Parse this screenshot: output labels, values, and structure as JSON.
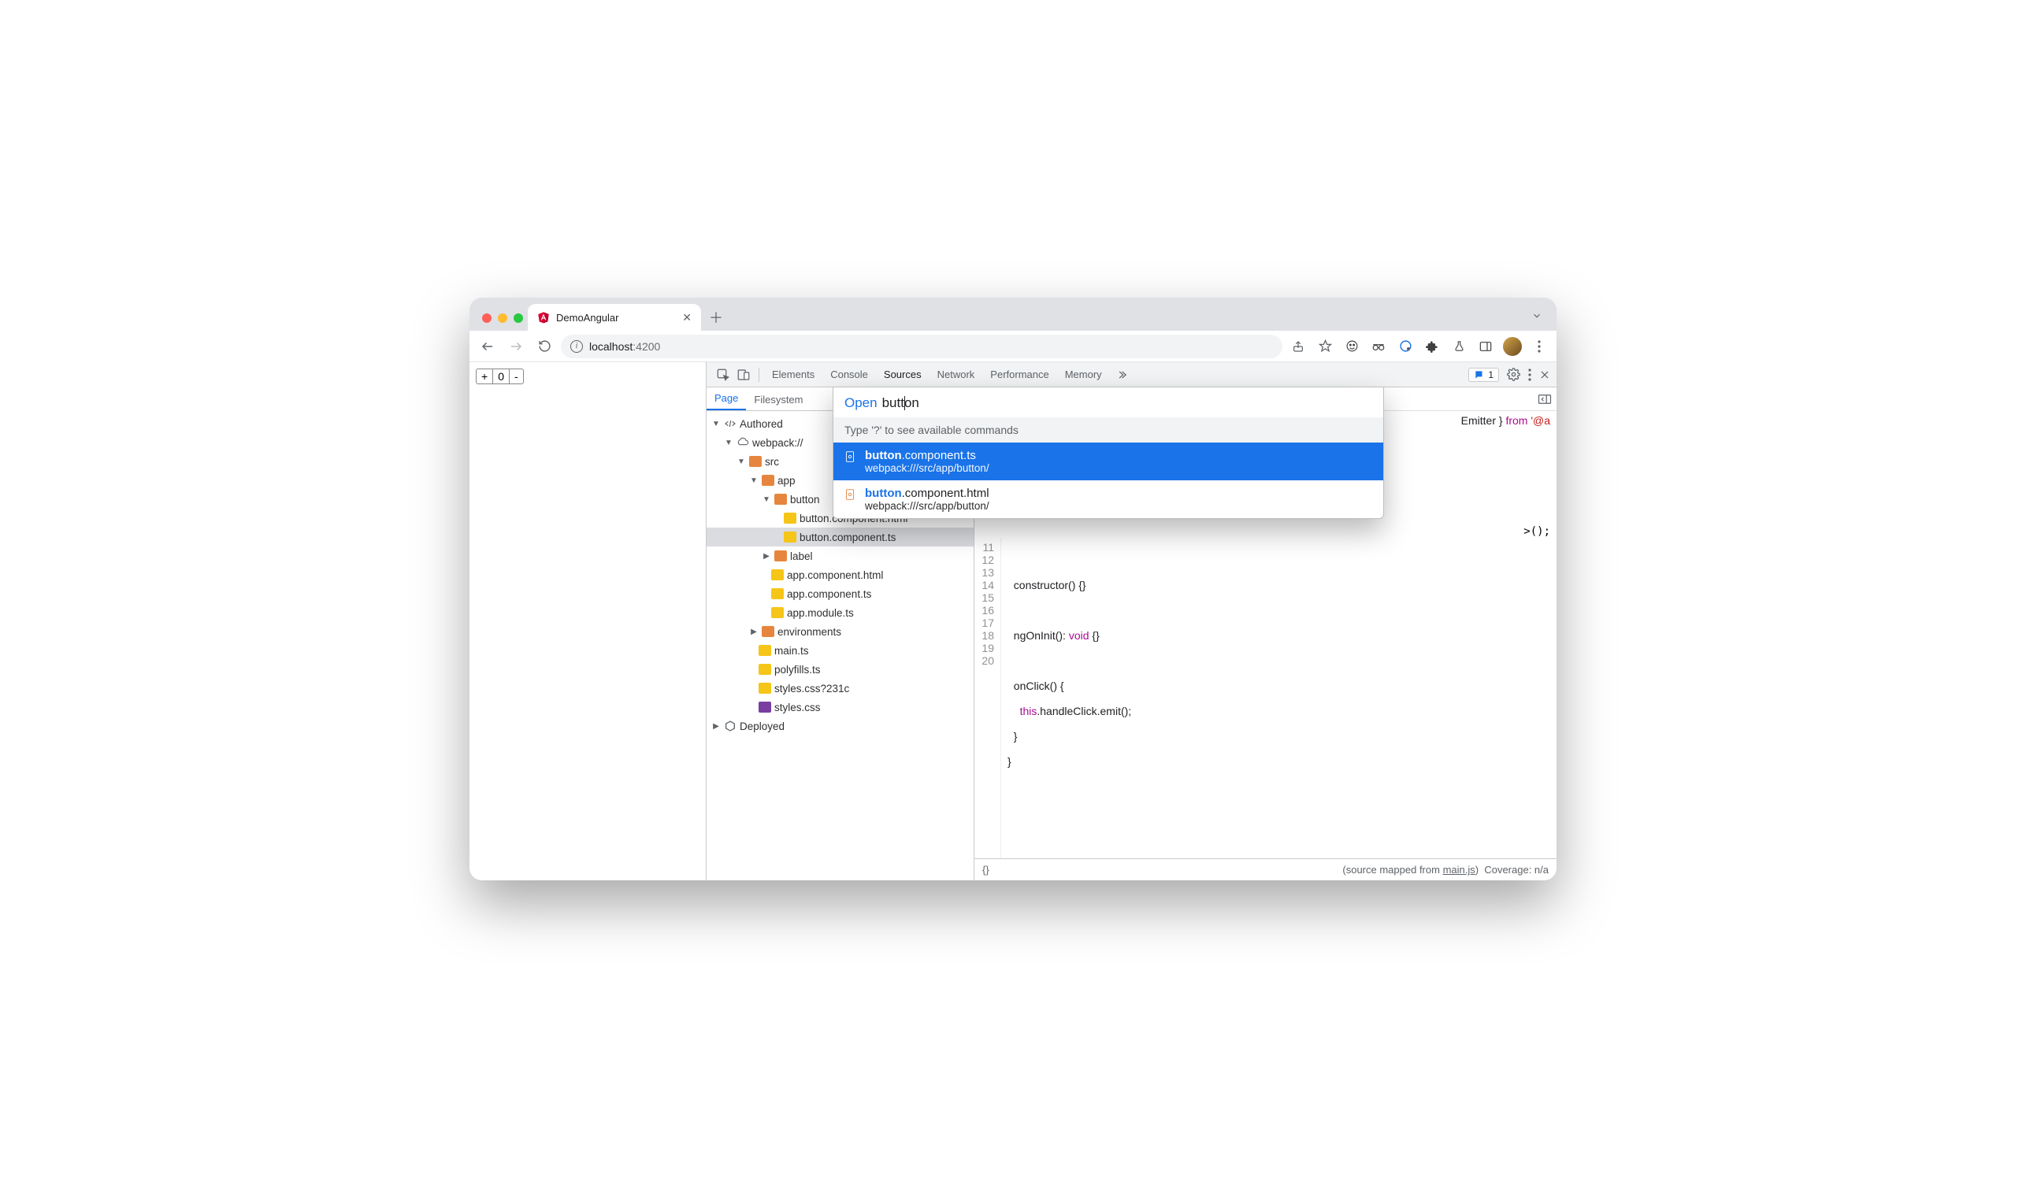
{
  "browser": {
    "tab_title": "DemoAngular",
    "url_host": "localhost",
    "url_port": ":4200"
  },
  "page_widget": {
    "plus": "+",
    "value": "0",
    "minus": "-"
  },
  "devtools": {
    "tabs": {
      "elements": "Elements",
      "console": "Console",
      "sources": "Sources",
      "network": "Network",
      "performance": "Performance",
      "memory": "Memory"
    },
    "issues_count": "1",
    "sources_nav": {
      "page": "Page",
      "filesystem": "Filesystem"
    },
    "tree": {
      "authored": "Authored",
      "webpack": "webpack://",
      "src": "src",
      "app": "app",
      "button_folder": "button",
      "button_html": "button.component.html",
      "button_ts": "button.component.ts",
      "label_folder": "label",
      "app_html": "app.component.html",
      "app_ts": "app.component.ts",
      "app_module": "app.module.ts",
      "env": "environments",
      "main": "main.ts",
      "polyfills": "polyfills.ts",
      "styles_q": "styles.css?231c",
      "styles": "styles.css",
      "deployed": "Deployed"
    },
    "status": {
      "braces": "{}",
      "mapped_from_prefix": "(source mapped from ",
      "mapped_from_link": "main.js",
      "mapped_from_suffix": ")",
      "coverage": "Coverage: n/a"
    },
    "editor": {
      "visible_fragment_1": "Emitter } ",
      "visible_fragment_from": "from",
      "visible_fragment_2": " '@a",
      "snippet_suffix": ">();",
      "lines": [
        "11",
        "12",
        "13",
        "14",
        "15",
        "16",
        "17",
        "18",
        "19",
        "20"
      ],
      "l12": "  constructor() {}",
      "l14a": "  ngOnInit(): ",
      "l14b": "void",
      "l14c": " {}",
      "l16": "  onClick() {",
      "l17a": "    ",
      "l17b": "this",
      "l17c": ".handleClick.emit();",
      "l18": "  }",
      "l19": "}"
    }
  },
  "openbox": {
    "label": "Open",
    "query": "button",
    "hint": "Type '?' to see available commands",
    "results": [
      {
        "match": "button",
        "rest": ".component.ts",
        "path": "webpack:///src/app/button/"
      },
      {
        "match": "button",
        "rest": ".component.html",
        "path": "webpack:///src/app/button/"
      }
    ]
  }
}
